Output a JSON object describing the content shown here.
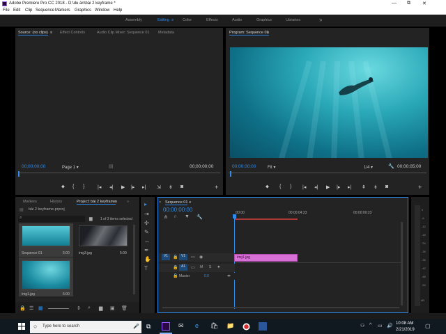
{
  "app": {
    "title": "Adobe Premiere Pro CC 2018 - D:\\du án\\bài 2 keyframe *"
  },
  "menu": [
    "File",
    "Edit",
    "Clip",
    "Sequence",
    "Markers",
    "Graphics",
    "Window",
    "Help"
  ],
  "workspaces": {
    "items": [
      "Assembly",
      "Editing",
      "Color",
      "Effects",
      "Audio",
      "Graphics",
      "Libraries"
    ],
    "active": "Editing",
    "more": "»"
  },
  "source": {
    "tabs": [
      "Source: (no clips)",
      "Effect Controls",
      "Audio Clip Mixer: Sequence 01",
      "Metadata"
    ],
    "timecode_left": "00;00;00;00",
    "page": "Page 1",
    "timecode_right": "00;00;00;00"
  },
  "program": {
    "tab": "Program: Sequence 01",
    "timecode_left": "00:00:00:00",
    "fit": "Fit",
    "resolution": "1/4",
    "timecode_right": "00:00:05:00"
  },
  "project": {
    "tabs": [
      "Markers",
      "History",
      "Project: bài 2 keyframe"
    ],
    "filename": "bài 2 keyframe.prproj",
    "selection": "1 of 3 items selected",
    "items": [
      {
        "name": "Sequence 01",
        "duration": "5:00"
      },
      {
        "name": "img3.jpg",
        "duration": "5:00"
      },
      {
        "name": "img1.jpg",
        "duration": "5:00"
      }
    ]
  },
  "sequence": {
    "tab": "Sequence 01",
    "timecode": "00:00:00:00",
    "ruler": [
      ":00:00",
      "00:00:04:23",
      "00:00:09:23"
    ],
    "clip": "img1.jpg",
    "video_track": "V1",
    "source_patch": "V1",
    "audio_track": "A1",
    "audio_patch": "A1",
    "master_label": "Master",
    "master_value": "0.0",
    "mute": "M",
    "solo": "S"
  },
  "meter": {
    "labels": [
      "0",
      "-6",
      "-12",
      "-18",
      "-24",
      "-30",
      "-36",
      "-42",
      "-48",
      "-54",
      "dB"
    ]
  },
  "taskbar": {
    "search_placeholder": "Type here to search",
    "time": "10:08 AM",
    "date": "2/21/2019"
  },
  "colors": {
    "accent": "#2d8ceb",
    "clip": "#d86fd6",
    "panel": "#232323"
  }
}
